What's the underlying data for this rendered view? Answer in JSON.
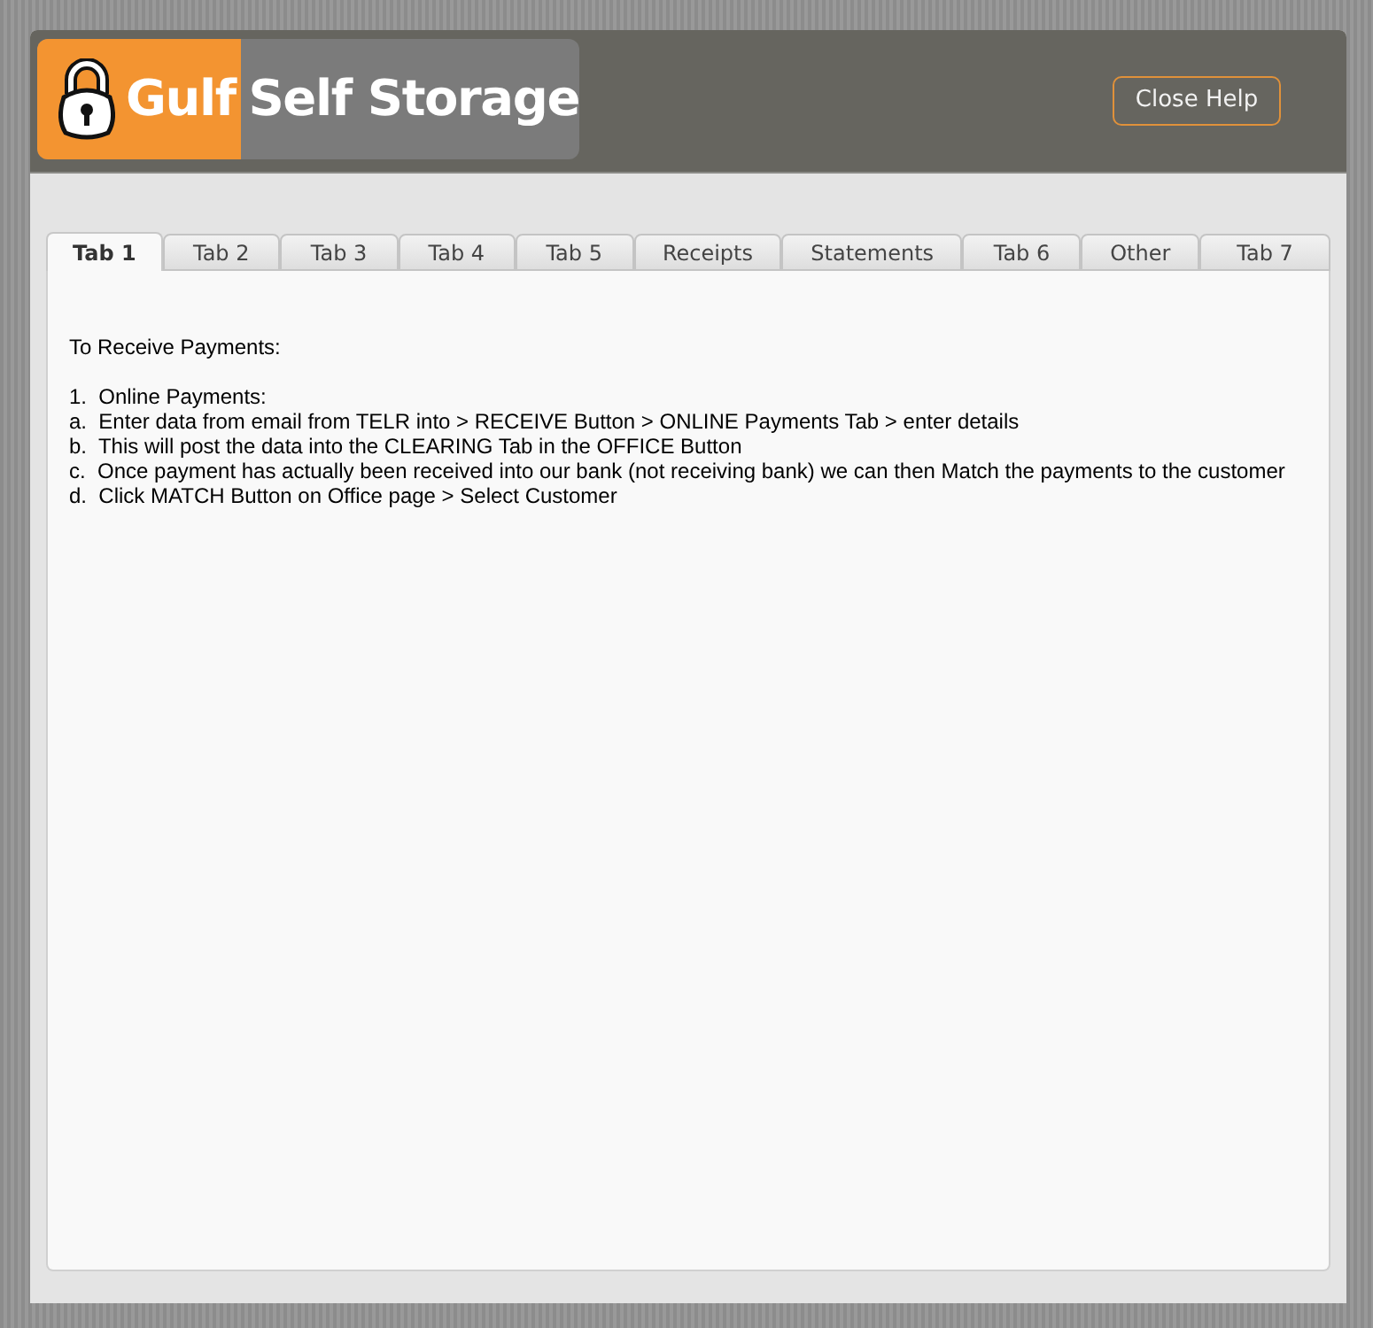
{
  "logo": {
    "brand": "Gulf",
    "rest": "Self Storage"
  },
  "close_button": "Close Help",
  "tabs": [
    {
      "label": "Tab 1",
      "selected": true
    },
    {
      "label": "Tab 2",
      "selected": false
    },
    {
      "label": "Tab 3",
      "selected": false
    },
    {
      "label": "Tab 4",
      "selected": false
    },
    {
      "label": "Tab 5",
      "selected": false
    },
    {
      "label": "Receipts",
      "selected": false
    },
    {
      "label": "Statements",
      "selected": false
    },
    {
      "label": "Tab 6",
      "selected": false
    },
    {
      "label": "Other",
      "selected": false
    },
    {
      "label": "Tab 7",
      "selected": false
    }
  ],
  "content": {
    "heading": "To Receive Payments:",
    "lines": [
      "1.  Online Payments:",
      "a.  Enter data from email from TELR into > RECEIVE Button > ONLINE Payments Tab > enter details",
      "b.  This will post the data into the CLEARING Tab in the OFFICE Button",
      "c.  Once payment has actually been received into our bank (not receiving bank) we can then Match the payments to the customer",
      "d.  Click MATCH Button on Office page > Select Customer"
    ]
  }
}
